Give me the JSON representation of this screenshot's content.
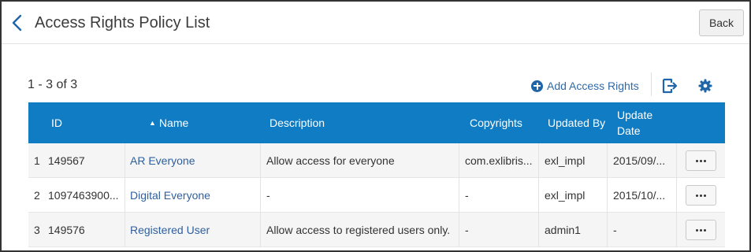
{
  "header": {
    "title": "Access Rights Policy List",
    "back_label": "Back"
  },
  "toolbar": {
    "count": "1 - 3 of 3",
    "add_label": "Add Access Rights"
  },
  "table": {
    "columns": {
      "id": "ID",
      "name": "Name",
      "description": "Description",
      "copyrights": "Copyrights",
      "updated_by": "Updated By",
      "update_date": "Update Date"
    },
    "sort_indicator": "▲",
    "rows": [
      {
        "num": "1",
        "id": "149567",
        "name": "AR Everyone",
        "description": "Allow access for everyone",
        "copyrights": "com.exlibris...",
        "updated_by": "exl_impl",
        "update_date": "2015/09/..."
      },
      {
        "num": "2",
        "id": "1097463900...",
        "name": "Digital Everyone",
        "description": "-",
        "copyrights": "-",
        "updated_by": "exl_impl",
        "update_date": "2015/10/..."
      },
      {
        "num": "3",
        "id": "149576",
        "name": "Registered User",
        "description": "Allow access to registered users only.",
        "copyrights": "-",
        "updated_by": "admin1",
        "update_date": "-"
      }
    ]
  },
  "colors": {
    "table_header": "#0f7cc4",
    "link": "#2f5f9e",
    "accent": "#1f65a8"
  },
  "icons": [
    "chevron-left-icon",
    "plus-circle-icon",
    "export-icon",
    "gear-icon",
    "more-options-icon"
  ]
}
